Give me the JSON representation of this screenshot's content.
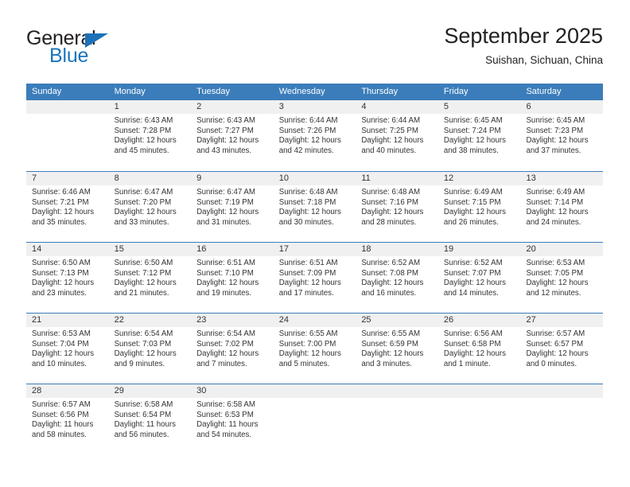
{
  "logo": {
    "word_top": "General",
    "word_bottom": "Blue",
    "triangle_color": "#1d71b8",
    "blue_color": "#1b75bb"
  },
  "header": {
    "title": "September 2025",
    "subtitle": "Suishan, Sichuan, China"
  },
  "theme": {
    "header_blue": "#3b7dba",
    "day_band_gray": "#f0f0f0",
    "text": "#333333"
  },
  "weekdays": [
    "Sunday",
    "Monday",
    "Tuesday",
    "Wednesday",
    "Thursday",
    "Friday",
    "Saturday"
  ],
  "weeks": [
    [
      {
        "day": "",
        "empty": true
      },
      {
        "day": "1",
        "sunrise": "Sunrise: 6:43 AM",
        "sunset": "Sunset: 7:28 PM",
        "daylight": "Daylight: 12 hours and 45 minutes."
      },
      {
        "day": "2",
        "sunrise": "Sunrise: 6:43 AM",
        "sunset": "Sunset: 7:27 PM",
        "daylight": "Daylight: 12 hours and 43 minutes."
      },
      {
        "day": "3",
        "sunrise": "Sunrise: 6:44 AM",
        "sunset": "Sunset: 7:26 PM",
        "daylight": "Daylight: 12 hours and 42 minutes."
      },
      {
        "day": "4",
        "sunrise": "Sunrise: 6:44 AM",
        "sunset": "Sunset: 7:25 PM",
        "daylight": "Daylight: 12 hours and 40 minutes."
      },
      {
        "day": "5",
        "sunrise": "Sunrise: 6:45 AM",
        "sunset": "Sunset: 7:24 PM",
        "daylight": "Daylight: 12 hours and 38 minutes."
      },
      {
        "day": "6",
        "sunrise": "Sunrise: 6:45 AM",
        "sunset": "Sunset: 7:23 PM",
        "daylight": "Daylight: 12 hours and 37 minutes."
      }
    ],
    [
      {
        "day": "7",
        "sunrise": "Sunrise: 6:46 AM",
        "sunset": "Sunset: 7:21 PM",
        "daylight": "Daylight: 12 hours and 35 minutes."
      },
      {
        "day": "8",
        "sunrise": "Sunrise: 6:47 AM",
        "sunset": "Sunset: 7:20 PM",
        "daylight": "Daylight: 12 hours and 33 minutes."
      },
      {
        "day": "9",
        "sunrise": "Sunrise: 6:47 AM",
        "sunset": "Sunset: 7:19 PM",
        "daylight": "Daylight: 12 hours and 31 minutes."
      },
      {
        "day": "10",
        "sunrise": "Sunrise: 6:48 AM",
        "sunset": "Sunset: 7:18 PM",
        "daylight": "Daylight: 12 hours and 30 minutes."
      },
      {
        "day": "11",
        "sunrise": "Sunrise: 6:48 AM",
        "sunset": "Sunset: 7:16 PM",
        "daylight": "Daylight: 12 hours and 28 minutes."
      },
      {
        "day": "12",
        "sunrise": "Sunrise: 6:49 AM",
        "sunset": "Sunset: 7:15 PM",
        "daylight": "Daylight: 12 hours and 26 minutes."
      },
      {
        "day": "13",
        "sunrise": "Sunrise: 6:49 AM",
        "sunset": "Sunset: 7:14 PM",
        "daylight": "Daylight: 12 hours and 24 minutes."
      }
    ],
    [
      {
        "day": "14",
        "sunrise": "Sunrise: 6:50 AM",
        "sunset": "Sunset: 7:13 PM",
        "daylight": "Daylight: 12 hours and 23 minutes."
      },
      {
        "day": "15",
        "sunrise": "Sunrise: 6:50 AM",
        "sunset": "Sunset: 7:12 PM",
        "daylight": "Daylight: 12 hours and 21 minutes."
      },
      {
        "day": "16",
        "sunrise": "Sunrise: 6:51 AM",
        "sunset": "Sunset: 7:10 PM",
        "daylight": "Daylight: 12 hours and 19 minutes."
      },
      {
        "day": "17",
        "sunrise": "Sunrise: 6:51 AM",
        "sunset": "Sunset: 7:09 PM",
        "daylight": "Daylight: 12 hours and 17 minutes."
      },
      {
        "day": "18",
        "sunrise": "Sunrise: 6:52 AM",
        "sunset": "Sunset: 7:08 PM",
        "daylight": "Daylight: 12 hours and 16 minutes."
      },
      {
        "day": "19",
        "sunrise": "Sunrise: 6:52 AM",
        "sunset": "Sunset: 7:07 PM",
        "daylight": "Daylight: 12 hours and 14 minutes."
      },
      {
        "day": "20",
        "sunrise": "Sunrise: 6:53 AM",
        "sunset": "Sunset: 7:05 PM",
        "daylight": "Daylight: 12 hours and 12 minutes."
      }
    ],
    [
      {
        "day": "21",
        "sunrise": "Sunrise: 6:53 AM",
        "sunset": "Sunset: 7:04 PM",
        "daylight": "Daylight: 12 hours and 10 minutes."
      },
      {
        "day": "22",
        "sunrise": "Sunrise: 6:54 AM",
        "sunset": "Sunset: 7:03 PM",
        "daylight": "Daylight: 12 hours and 9 minutes."
      },
      {
        "day": "23",
        "sunrise": "Sunrise: 6:54 AM",
        "sunset": "Sunset: 7:02 PM",
        "daylight": "Daylight: 12 hours and 7 minutes."
      },
      {
        "day": "24",
        "sunrise": "Sunrise: 6:55 AM",
        "sunset": "Sunset: 7:00 PM",
        "daylight": "Daylight: 12 hours and 5 minutes."
      },
      {
        "day": "25",
        "sunrise": "Sunrise: 6:55 AM",
        "sunset": "Sunset: 6:59 PM",
        "daylight": "Daylight: 12 hours and 3 minutes."
      },
      {
        "day": "26",
        "sunrise": "Sunrise: 6:56 AM",
        "sunset": "Sunset: 6:58 PM",
        "daylight": "Daylight: 12 hours and 1 minute."
      },
      {
        "day": "27",
        "sunrise": "Sunrise: 6:57 AM",
        "sunset": "Sunset: 6:57 PM",
        "daylight": "Daylight: 12 hours and 0 minutes."
      }
    ],
    [
      {
        "day": "28",
        "sunrise": "Sunrise: 6:57 AM",
        "sunset": "Sunset: 6:56 PM",
        "daylight": "Daylight: 11 hours and 58 minutes."
      },
      {
        "day": "29",
        "sunrise": "Sunrise: 6:58 AM",
        "sunset": "Sunset: 6:54 PM",
        "daylight": "Daylight: 11 hours and 56 minutes."
      },
      {
        "day": "30",
        "sunrise": "Sunrise: 6:58 AM",
        "sunset": "Sunset: 6:53 PM",
        "daylight": "Daylight: 11 hours and 54 minutes."
      },
      {
        "day": "",
        "empty": true
      },
      {
        "day": "",
        "empty": true
      },
      {
        "day": "",
        "empty": true
      },
      {
        "day": "",
        "empty": true
      }
    ]
  ]
}
